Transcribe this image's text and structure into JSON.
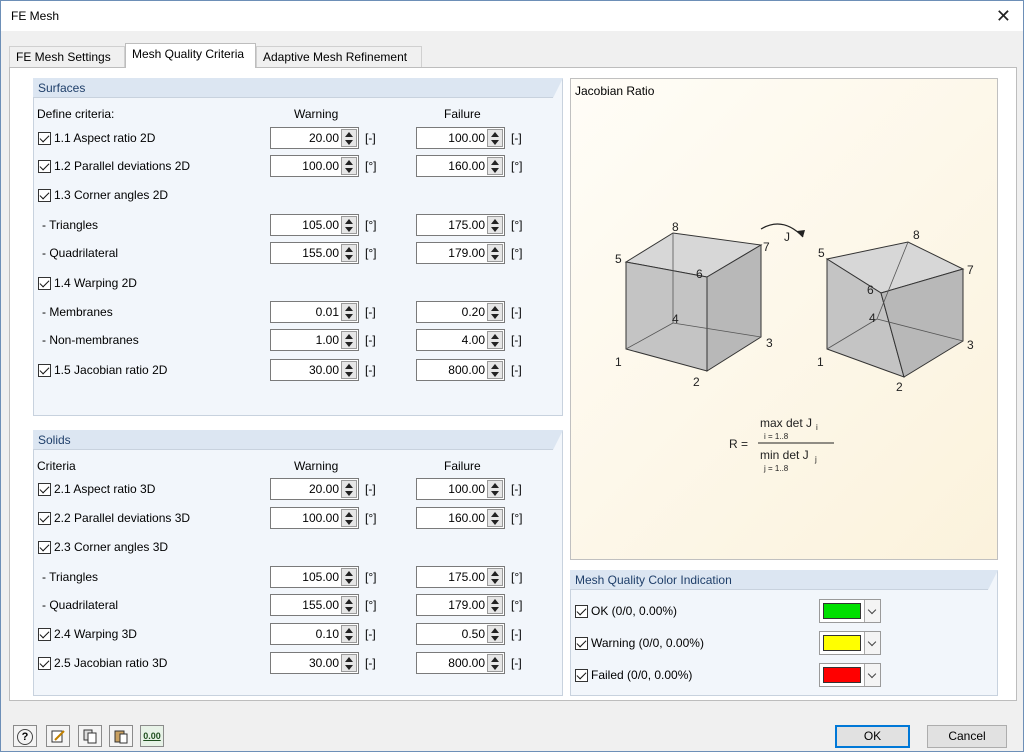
{
  "window": {
    "title": "FE Mesh",
    "close_glyph": "✕"
  },
  "tabs": [
    {
      "label": "FE Mesh Settings"
    },
    {
      "label": "Mesh Quality Criteria"
    },
    {
      "label": "Adaptive Mesh Refinement"
    }
  ],
  "surfaces": {
    "title": "Surfaces",
    "criteria_label": "Define criteria:",
    "warning_header": "Warning",
    "failure_header": "Failure",
    "rows": [
      {
        "label": "1.1 Aspect ratio 2D",
        "checked": true,
        "warning": "20.00",
        "failure": "100.00",
        "unit": "[-]"
      },
      {
        "label": "1.2 Parallel deviations 2D",
        "checked": true,
        "warning": "100.00",
        "failure": "160.00",
        "unit": "[°]"
      },
      {
        "label": "1.3 Corner angles 2D",
        "checked": true
      },
      {
        "label": "- Triangles",
        "warning": "105.00",
        "failure": "175.00",
        "unit": "[°]"
      },
      {
        "label": "- Quadrilateral",
        "warning": "155.00",
        "failure": "179.00",
        "unit": "[°]"
      },
      {
        "label": "1.4 Warping 2D",
        "checked": true
      },
      {
        "label": "- Membranes",
        "warning": "0.01",
        "failure": "0.20",
        "unit": "[-]"
      },
      {
        "label": "- Non-membranes",
        "warning": "1.00",
        "failure": "4.00",
        "unit": "[-]"
      },
      {
        "label": "1.5 Jacobian ratio 2D",
        "checked": true,
        "warning": "30.00",
        "failure": "800.00",
        "unit": "[-]"
      }
    ]
  },
  "solids": {
    "title": "Solids",
    "criteria_label": "Criteria",
    "warning_header": "Warning",
    "failure_header": "Failure",
    "rows": [
      {
        "label": "2.1 Aspect ratio 3D",
        "checked": true,
        "warning": "20.00",
        "failure": "100.00",
        "unit": "[-]"
      },
      {
        "label": "2.2 Parallel deviations 3D",
        "checked": true,
        "warning": "100.00",
        "failure": "160.00",
        "unit": "[°]"
      },
      {
        "label": "2.3 Corner angles 3D",
        "checked": true
      },
      {
        "label": "- Triangles",
        "warning": "105.00",
        "failure": "175.00",
        "unit": "[°]"
      },
      {
        "label": "- Quadrilateral",
        "warning": "155.00",
        "failure": "179.00",
        "unit": "[°]"
      },
      {
        "label": "2.4 Warping 3D",
        "checked": true,
        "warning": "0.10",
        "failure": "0.50",
        "unit": "[-]"
      },
      {
        "label": "2.5 Jacobian ratio 3D",
        "checked": true,
        "warning": "30.00",
        "failure": "800.00",
        "unit": "[-]"
      }
    ]
  },
  "jacobian": {
    "title": "Jacobian Ratio",
    "mapping_label": "J",
    "cube_left_nodes": [
      "1",
      "2",
      "3",
      "4",
      "5",
      "6",
      "7",
      "8"
    ],
    "cube_right_nodes": [
      "1",
      "2",
      "3",
      "4",
      "5",
      "6",
      "7",
      "8"
    ],
    "formula": {
      "lhs": "R =",
      "num_main": "max det J",
      "num_sub": "i",
      "num_range": "i = 1..8",
      "den_main": "min det J",
      "den_sub": "j",
      "den_range": "j = 1..8"
    }
  },
  "color_indication": {
    "title": "Mesh Quality Color Indication",
    "items": [
      {
        "label": "OK (0/0, 0.00%)",
        "checked": true,
        "color": "#00e000"
      },
      {
        "label": "Warning (0/0, 0.00%)",
        "checked": true,
        "color": "#ffff00"
      },
      {
        "label": "Failed (0/0, 0.00%)",
        "checked": true,
        "color": "#ff0000"
      }
    ]
  },
  "footer": {
    "tool_icons": [
      "help-icon",
      "edit-icon",
      "copy-icon",
      "paste-icon",
      "decimal-icon"
    ],
    "decimal_label": "0.00",
    "help_label": "?",
    "ok_label": "OK",
    "cancel_label": "Cancel"
  }
}
